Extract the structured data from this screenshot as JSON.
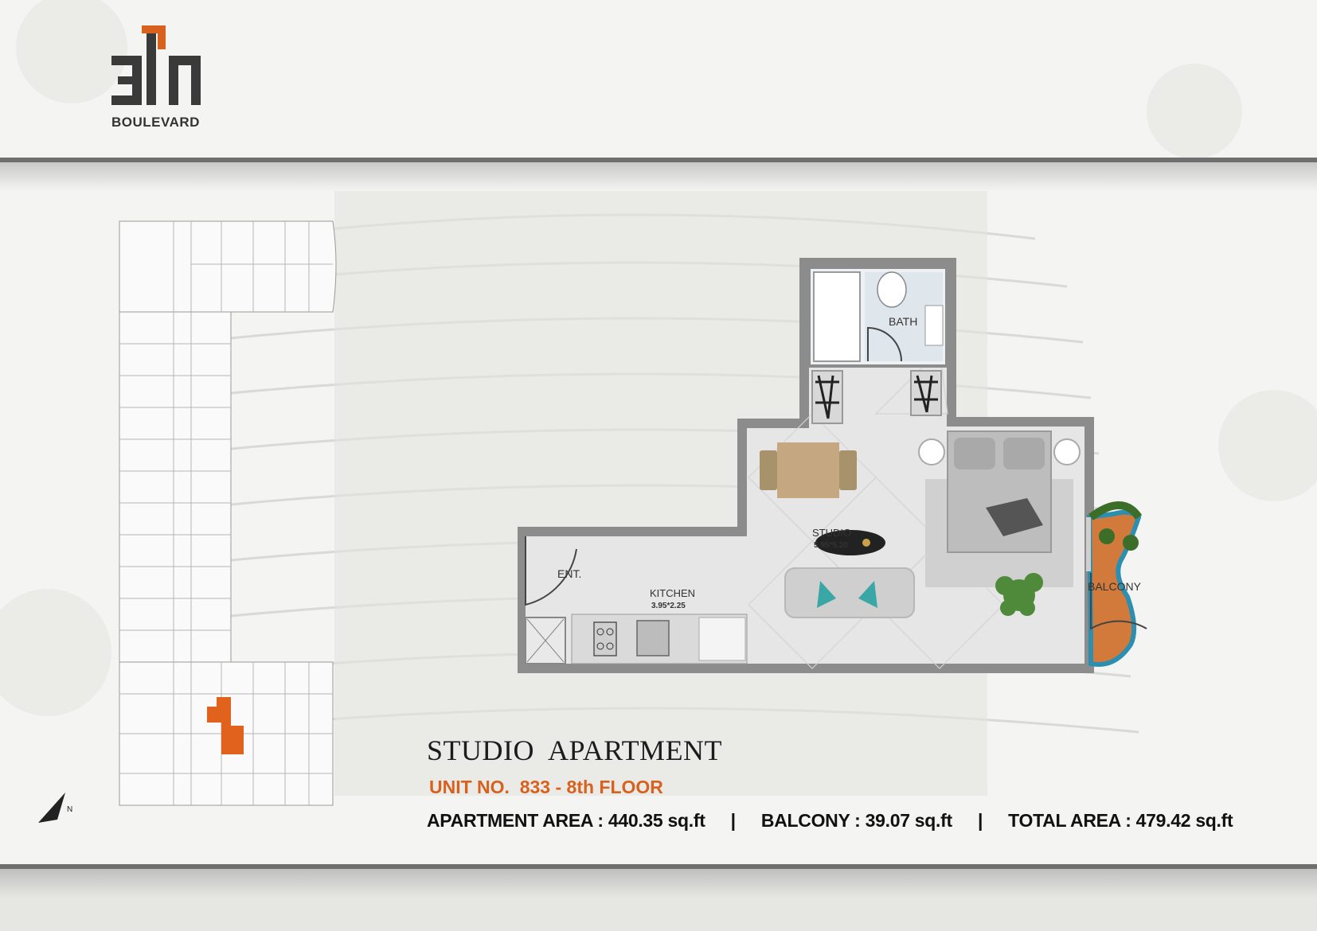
{
  "brand": {
    "logo_mark": "311",
    "wordmark": "BOULEVARD",
    "accent_color": "#d8611e"
  },
  "floor_plan": {
    "rooms": {
      "bath": "BATH",
      "studio": "STUDIO",
      "studio_dim": "5.95*5.20",
      "entrance": "ENT.",
      "kitchen": "KITCHEN",
      "kitchen_dim": "3.95*2.25",
      "balcony": "BALCONY"
    }
  },
  "key_plan": {
    "highlight_color": "#e0621c",
    "compass_icon": "north-arrow-icon"
  },
  "unit_info": {
    "title": "STUDIO  APARTMENT",
    "unit_line": "UNIT NO.  833 - 8th FLOOR",
    "apartment_area": "APARTMENT AREA : 440.35 sq.ft",
    "separator": "|",
    "balcony_area": "BALCONY : 39.07 sq.ft",
    "total_area": "TOTAL AREA : 479.42 sq.ft"
  }
}
